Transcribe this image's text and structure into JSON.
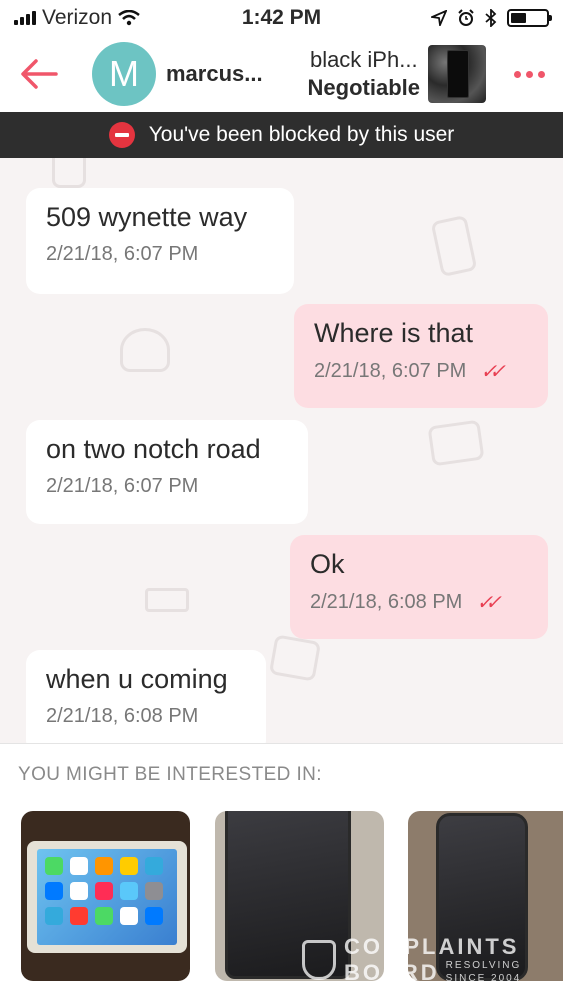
{
  "status_bar": {
    "carrier": "Verizon",
    "time": "1:42 PM",
    "battery_level": 0.45
  },
  "header": {
    "avatar_letter": "M",
    "username": "marcus...",
    "item_title": "black iPh...",
    "item_price": "Negotiable",
    "accent_color": "#f0566a"
  },
  "banner": {
    "text": "You've been blocked by this user",
    "icon": "no-entry-icon"
  },
  "messages": [
    {
      "direction": "incoming",
      "text": "509 wynette way",
      "timestamp": "2/21/18, 6:07 PM"
    },
    {
      "direction": "outgoing",
      "text": "Where is that",
      "timestamp": "2/21/18, 6:07 PM",
      "read": true
    },
    {
      "direction": "incoming",
      "text": "on two notch road",
      "timestamp": "2/21/18, 6:07 PM"
    },
    {
      "direction": "outgoing",
      "text": "Ok",
      "timestamp": "2/21/18, 6:08 PM",
      "read": true
    },
    {
      "direction": "incoming",
      "text": "when u coming",
      "timestamp": "2/21/18, 6:08 PM"
    }
  ],
  "suggestions": {
    "title": "YOU MIGHT BE INTERESTED IN:"
  },
  "watermark": {
    "line1": "COMPLAINTS",
    "line2": "BOARD",
    "tagline1": "RESOLVING",
    "tagline2": "SINCE 2004"
  }
}
